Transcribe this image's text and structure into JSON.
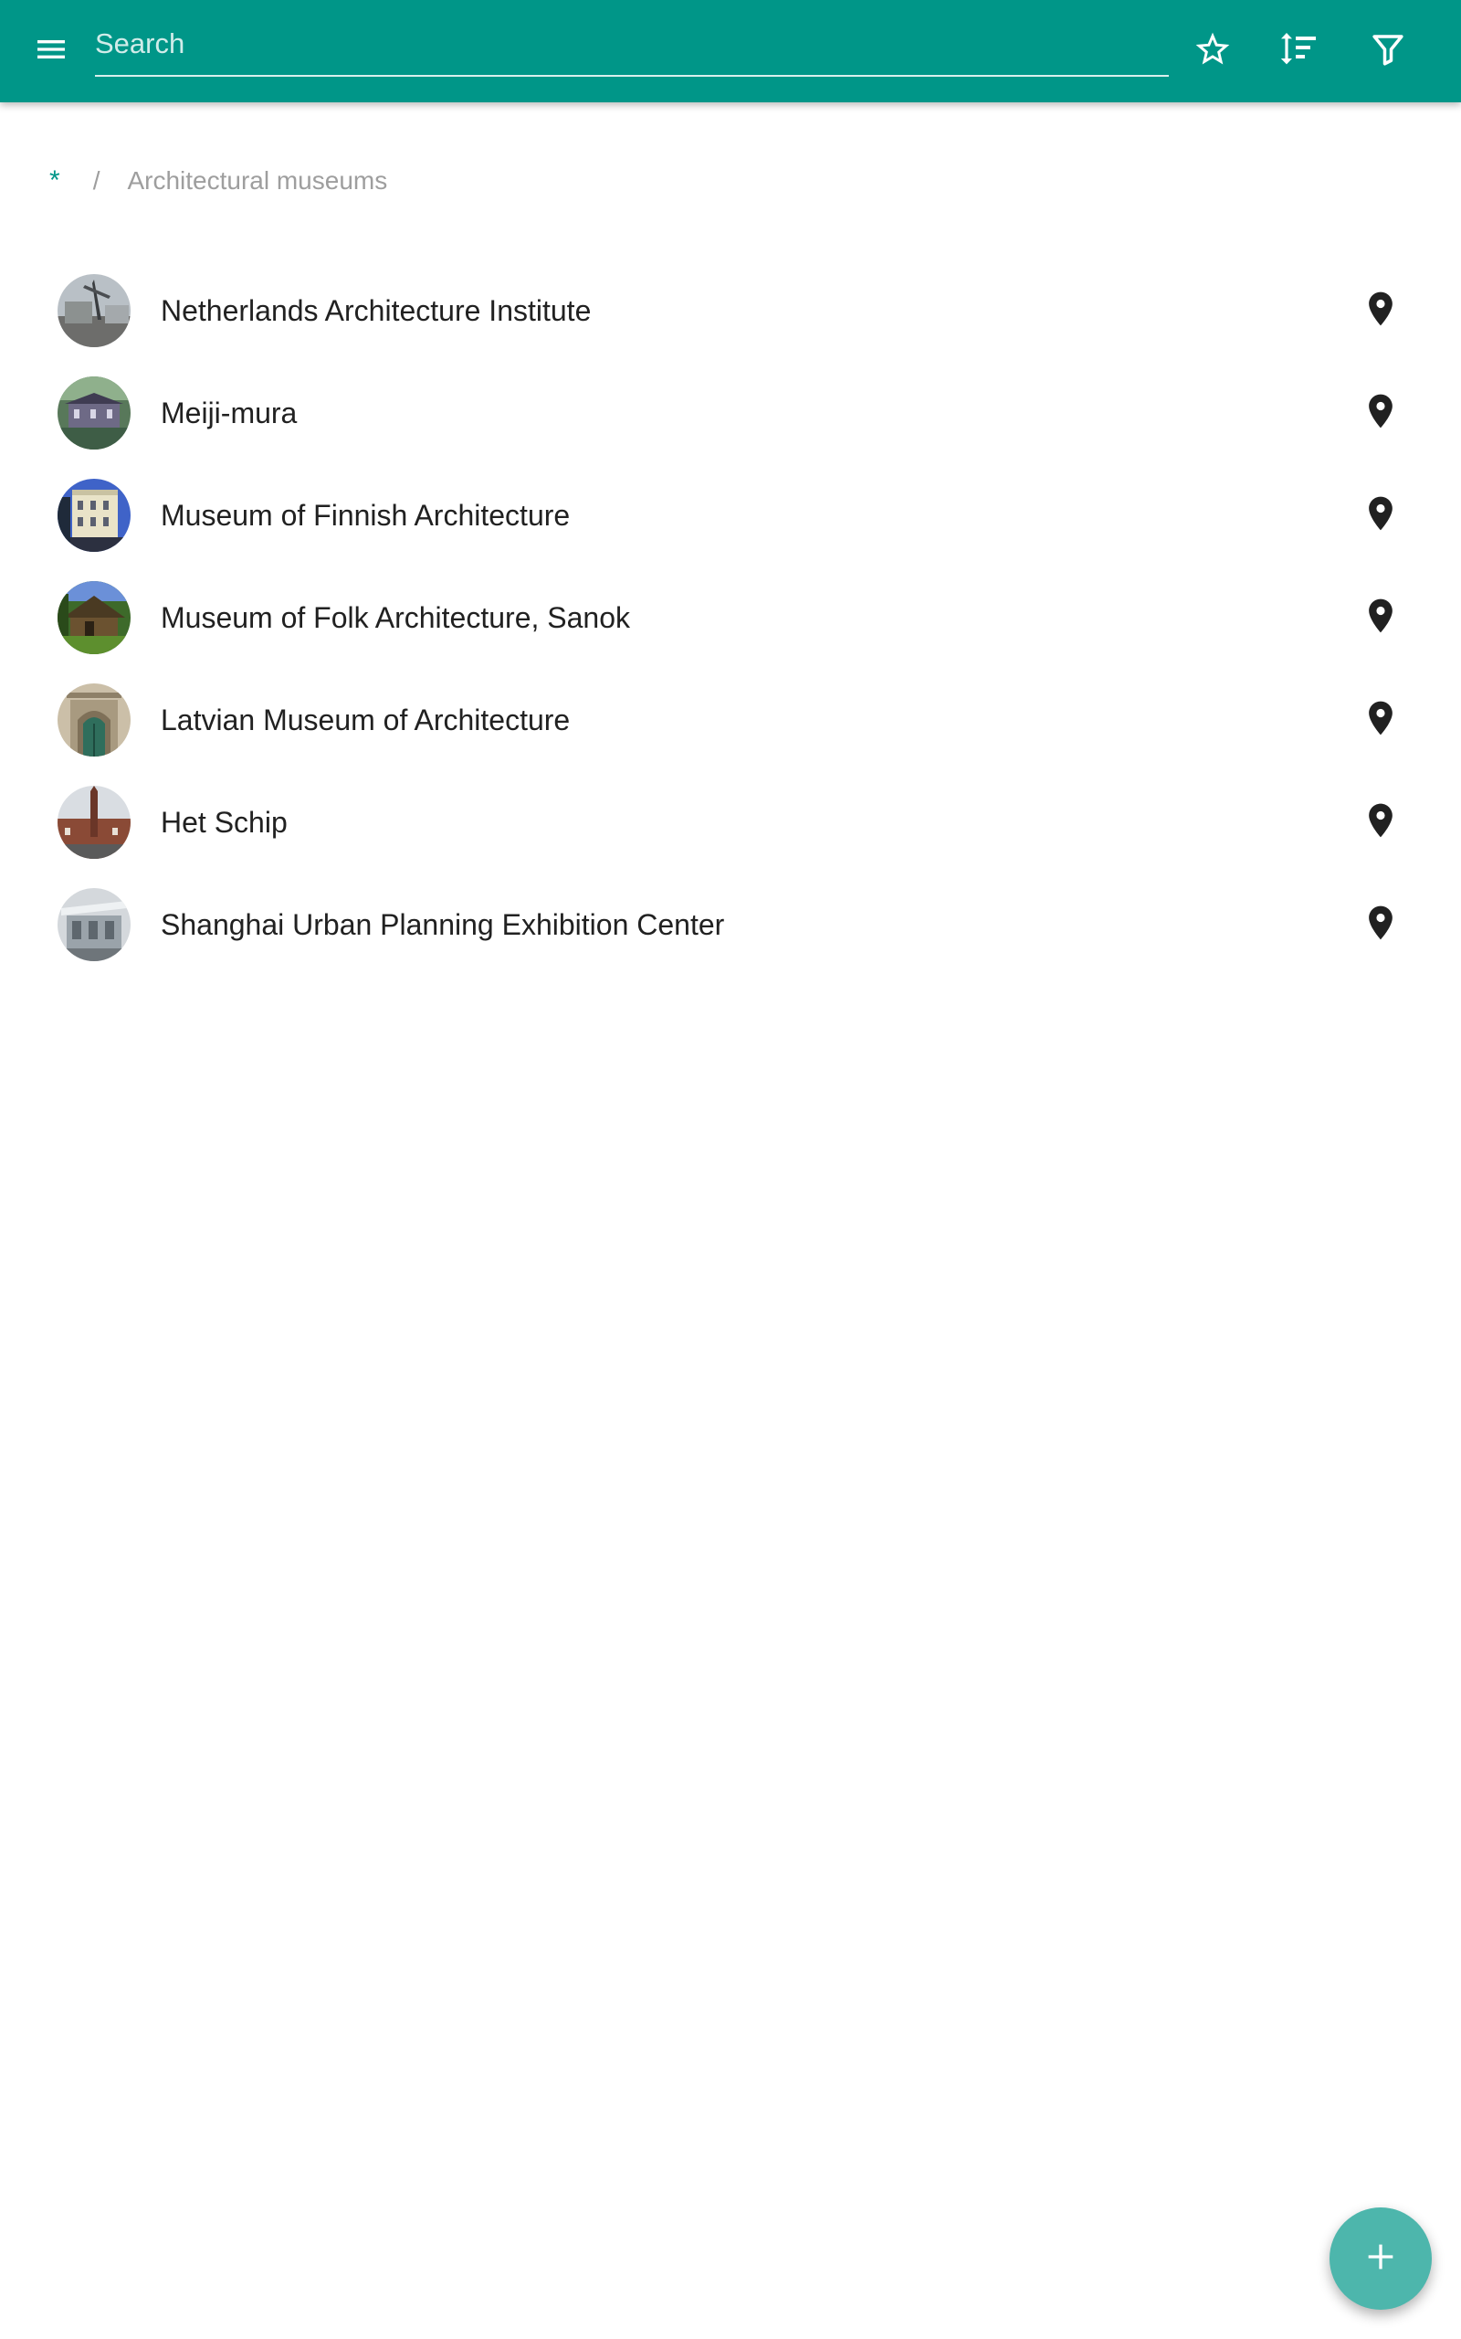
{
  "appbar": {
    "background_color": "#009688",
    "menu_icon": "menu-icon",
    "search": {
      "placeholder": "Search",
      "value": ""
    },
    "actions": [
      {
        "name": "favorites",
        "icon": "star-outline-icon"
      },
      {
        "name": "sort",
        "icon": "sort-icon"
      },
      {
        "name": "filter",
        "icon": "filter-icon"
      }
    ]
  },
  "breadcrumb": {
    "root": "*",
    "separator": "/",
    "current": "Architectural museums"
  },
  "list": {
    "items": [
      {
        "title": "Netherlands Architecture Institute",
        "icon": "map-marker-icon"
      },
      {
        "title": "Meiji-mura",
        "icon": "map-marker-icon"
      },
      {
        "title": "Museum of Finnish Architecture",
        "icon": "map-marker-icon"
      },
      {
        "title": "Museum of Folk Architecture, Sanok",
        "icon": "map-marker-icon"
      },
      {
        "title": "Latvian Museum of Architecture",
        "icon": "map-marker-icon"
      },
      {
        "title": "Het Schip",
        "icon": "map-marker-icon"
      },
      {
        "title": "Shanghai Urban Planning Exhibition Center",
        "icon": "map-marker-icon"
      }
    ]
  },
  "fab": {
    "icon": "plus-icon",
    "color": "#4db6ac"
  }
}
